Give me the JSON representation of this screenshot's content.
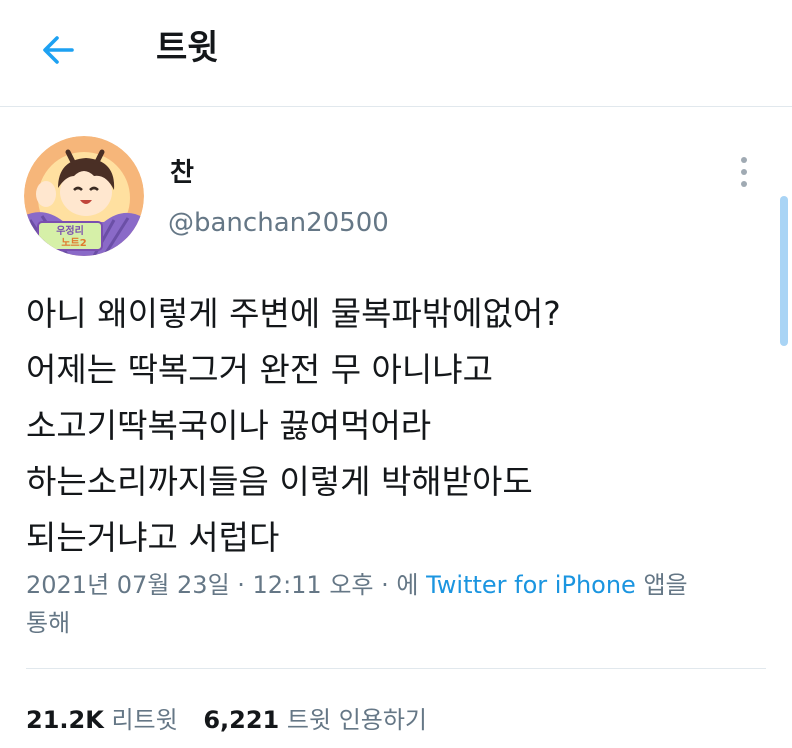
{
  "header": {
    "title": "트윗",
    "back_icon": "arrow-left-icon",
    "accent_color": "#1da1f2"
  },
  "tweet": {
    "author_name": "찬",
    "author_handle": "@banchan20500",
    "avatar_icon": "cartoon-avatar",
    "avatar_text": "우정리 노트2",
    "lines": [
      "아니 왜이렇게 주변에 물복파밖에없어?",
      "어제는 딱복그거 완전 무 아니냐고",
      "소고기딱복국이나 끓여먹어라",
      "하는소리까지들음 이렇게 박해받아도",
      "되는거냐고 서럽다"
    ],
    "timestamp": "2021년 07월 23일 · 12:11 오후 · 에",
    "source": "Twitter for iPhone",
    "source_suffix": "앱을",
    "source_suffix2": "통해",
    "retweets_count": "21.2K",
    "retweets_label": "리트윗",
    "quotes_count": "6,221",
    "quotes_label": "트윗 인용하기"
  }
}
